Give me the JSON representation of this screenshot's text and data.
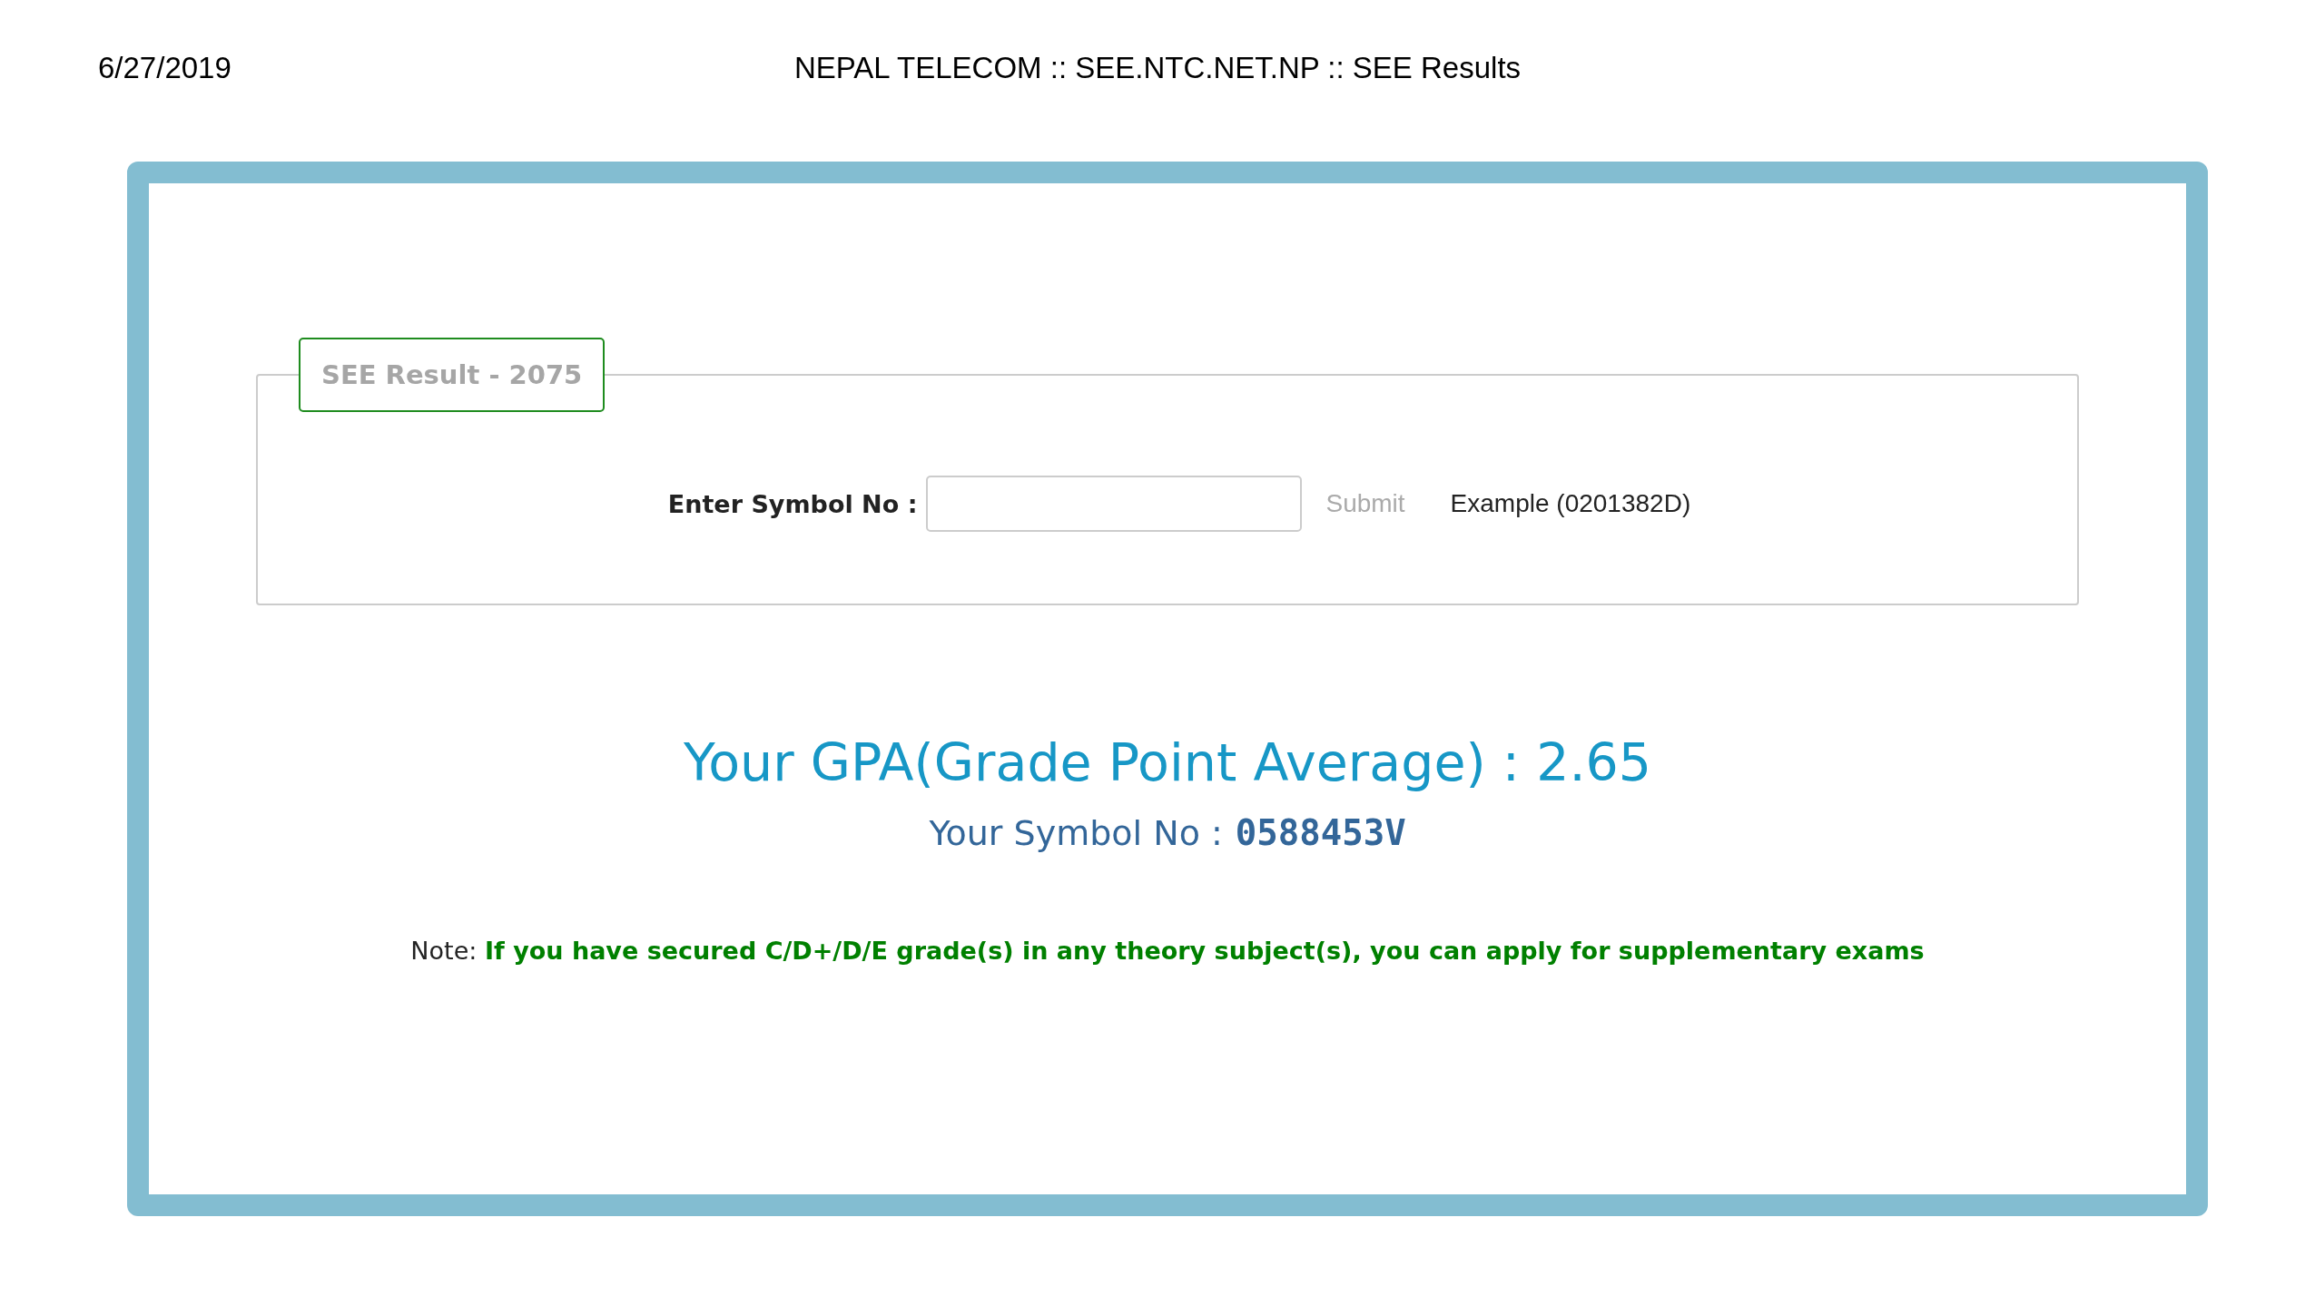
{
  "page_header": {
    "date": "6/27/2019",
    "title": "NEPAL TELECOM :: SEE.NTC.NET.NP :: SEE Results"
  },
  "form": {
    "legend": "SEE Result - 2075",
    "field_label": "Enter Symbol No :",
    "submit": "Submit",
    "example": "Example (0201382D)"
  },
  "result": {
    "gpa": "Your GPA(Grade Point Average) : 2.65",
    "symbol_label": "Your Symbol No :",
    "symbol_value": "0588453V"
  },
  "note": "Note: **If you have secured C/D+/D/E grade(s) in any theory subject(s), you can apply for supplementary exams**"
}
